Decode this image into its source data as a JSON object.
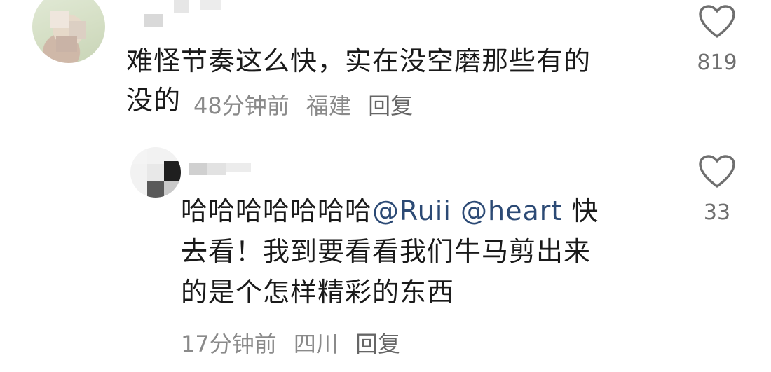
{
  "comments": [
    {
      "text_line1": "难怪节奏这么快，实在没空磨那些有的",
      "text_line2": "没的",
      "time": "48分钟前",
      "location": "福建",
      "reply_label": "回复",
      "likes": "819"
    },
    {
      "text_prefix": "哈哈哈哈哈哈哈",
      "mention1": "@Ruii",
      "mention2": "@heart",
      "text_after_mentions": "快",
      "text_line2": "去看！我到要看看我们牛马剪出来",
      "text_line3": "的是个怎样精彩的东西",
      "time": "17分钟前",
      "location": "四川",
      "reply_label": "回复",
      "likes": "33"
    }
  ],
  "icons": {
    "like": "heart-outline-icon"
  },
  "colors": {
    "text": "#1a1a1a",
    "meta": "#8a8a8a",
    "mention": "#2c4a75",
    "icon": "#6f6f6f"
  }
}
